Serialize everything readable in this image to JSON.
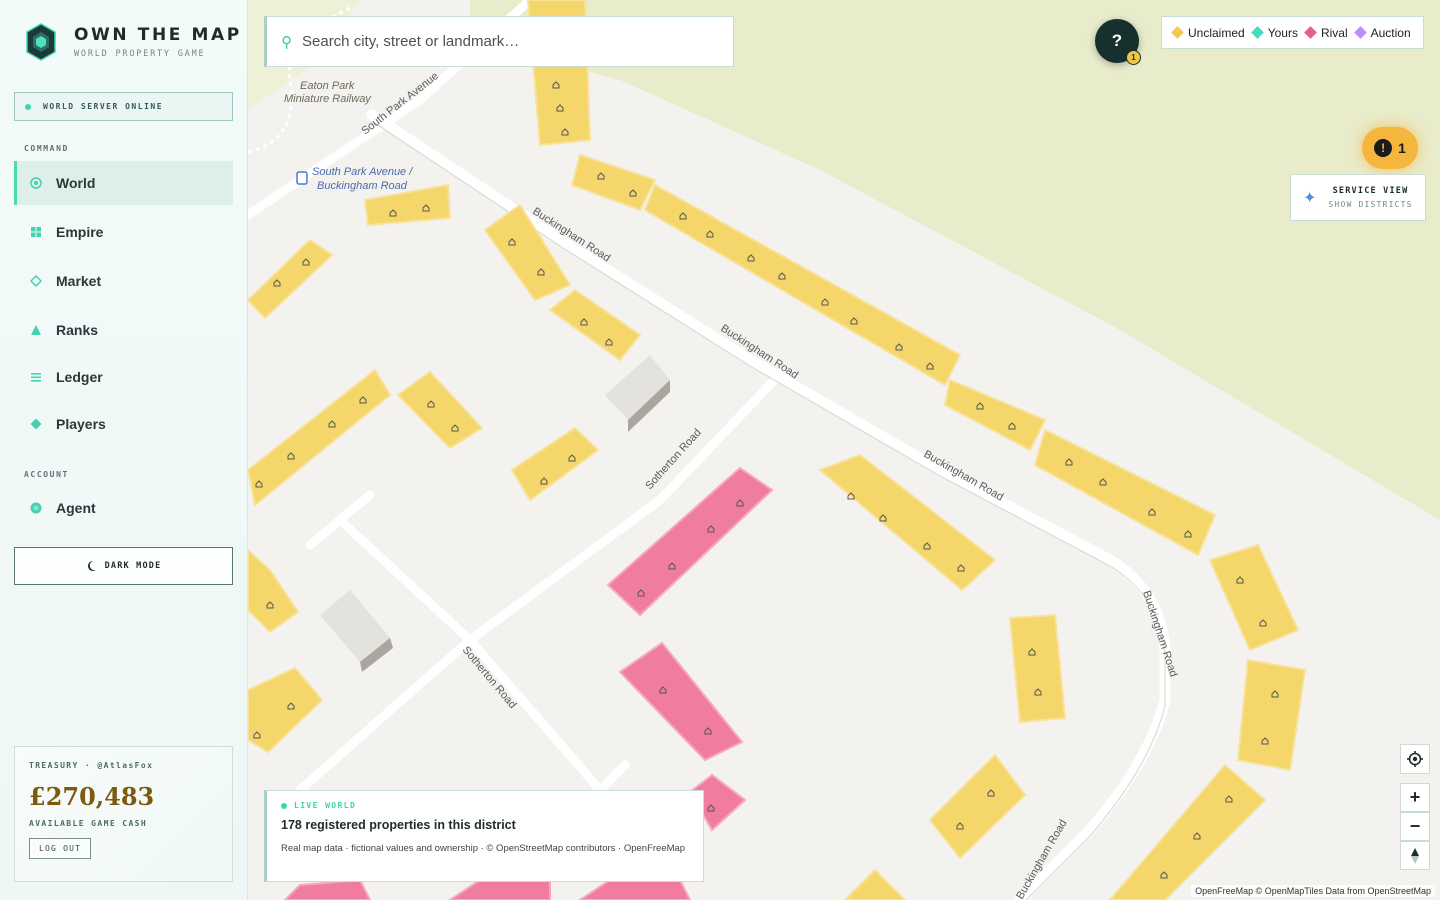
{
  "brand": {
    "title": "OWN THE MAP",
    "subtitle": "WORLD PROPERTY GAME",
    "logo_icon": "hexagon-gem-icon"
  },
  "server": {
    "status": "WORLD SERVER ONLINE",
    "color": "#3ad6b0"
  },
  "sections": {
    "command": "COMMAND",
    "account": "ACCOUNT"
  },
  "nav": {
    "world": "World",
    "empire": "Empire",
    "market": "Market",
    "ranks": "Ranks",
    "ledger": "Ledger",
    "players": "Players",
    "agent": "Agent"
  },
  "dark_mode": {
    "label": "DARK MODE",
    "icon": "crescent-moon-icon"
  },
  "treasury": {
    "label": "TREASURY · @AtlasFox",
    "amount": "£270,483",
    "sub": "AVAILABLE GAME CASH",
    "logout": "LOG OUT"
  },
  "search": {
    "placeholder": "Search city, street or landmark…"
  },
  "help": {
    "label": "?",
    "badge": "1"
  },
  "legend": [
    {
      "label": "Unclaimed",
      "color": "#f5c94a"
    },
    {
      "label": "Yours",
      "color": "#46dcc3"
    },
    {
      "label": "Rival",
      "color": "#e2637f"
    },
    {
      "label": "Auction",
      "color": "#c08ef0"
    }
  ],
  "alerts": {
    "count": "1"
  },
  "service_view": {
    "title": "SERVICE VIEW",
    "sub": "SHOW DISTRICTS"
  },
  "info": {
    "live": "LIVE WORLD",
    "title": "178 registered properties in this district",
    "note": "Real map data · fictional values and ownership · © OpenStreetMap contributors · OpenFreeMap"
  },
  "map_labels": {
    "eaton_park": "Eaton Park",
    "miniature_railway": "Miniature Railway",
    "south_park_avenue": "South Park Avenue",
    "bus_stop_line1": "South Park Avenue /",
    "bus_stop_line2": "Buckingham Road",
    "buckingham_road": "Buckingham Road",
    "sotherton_road": "Sotherton Road"
  },
  "attribution": "OpenFreeMap © OpenMapTiles Data from OpenStreetMap",
  "colors": {
    "unclaimed": "#f5d66a",
    "rival": "#f07d9f",
    "park": "#e9eccb",
    "road": "#ffffff",
    "background": "#f4f2ee"
  }
}
